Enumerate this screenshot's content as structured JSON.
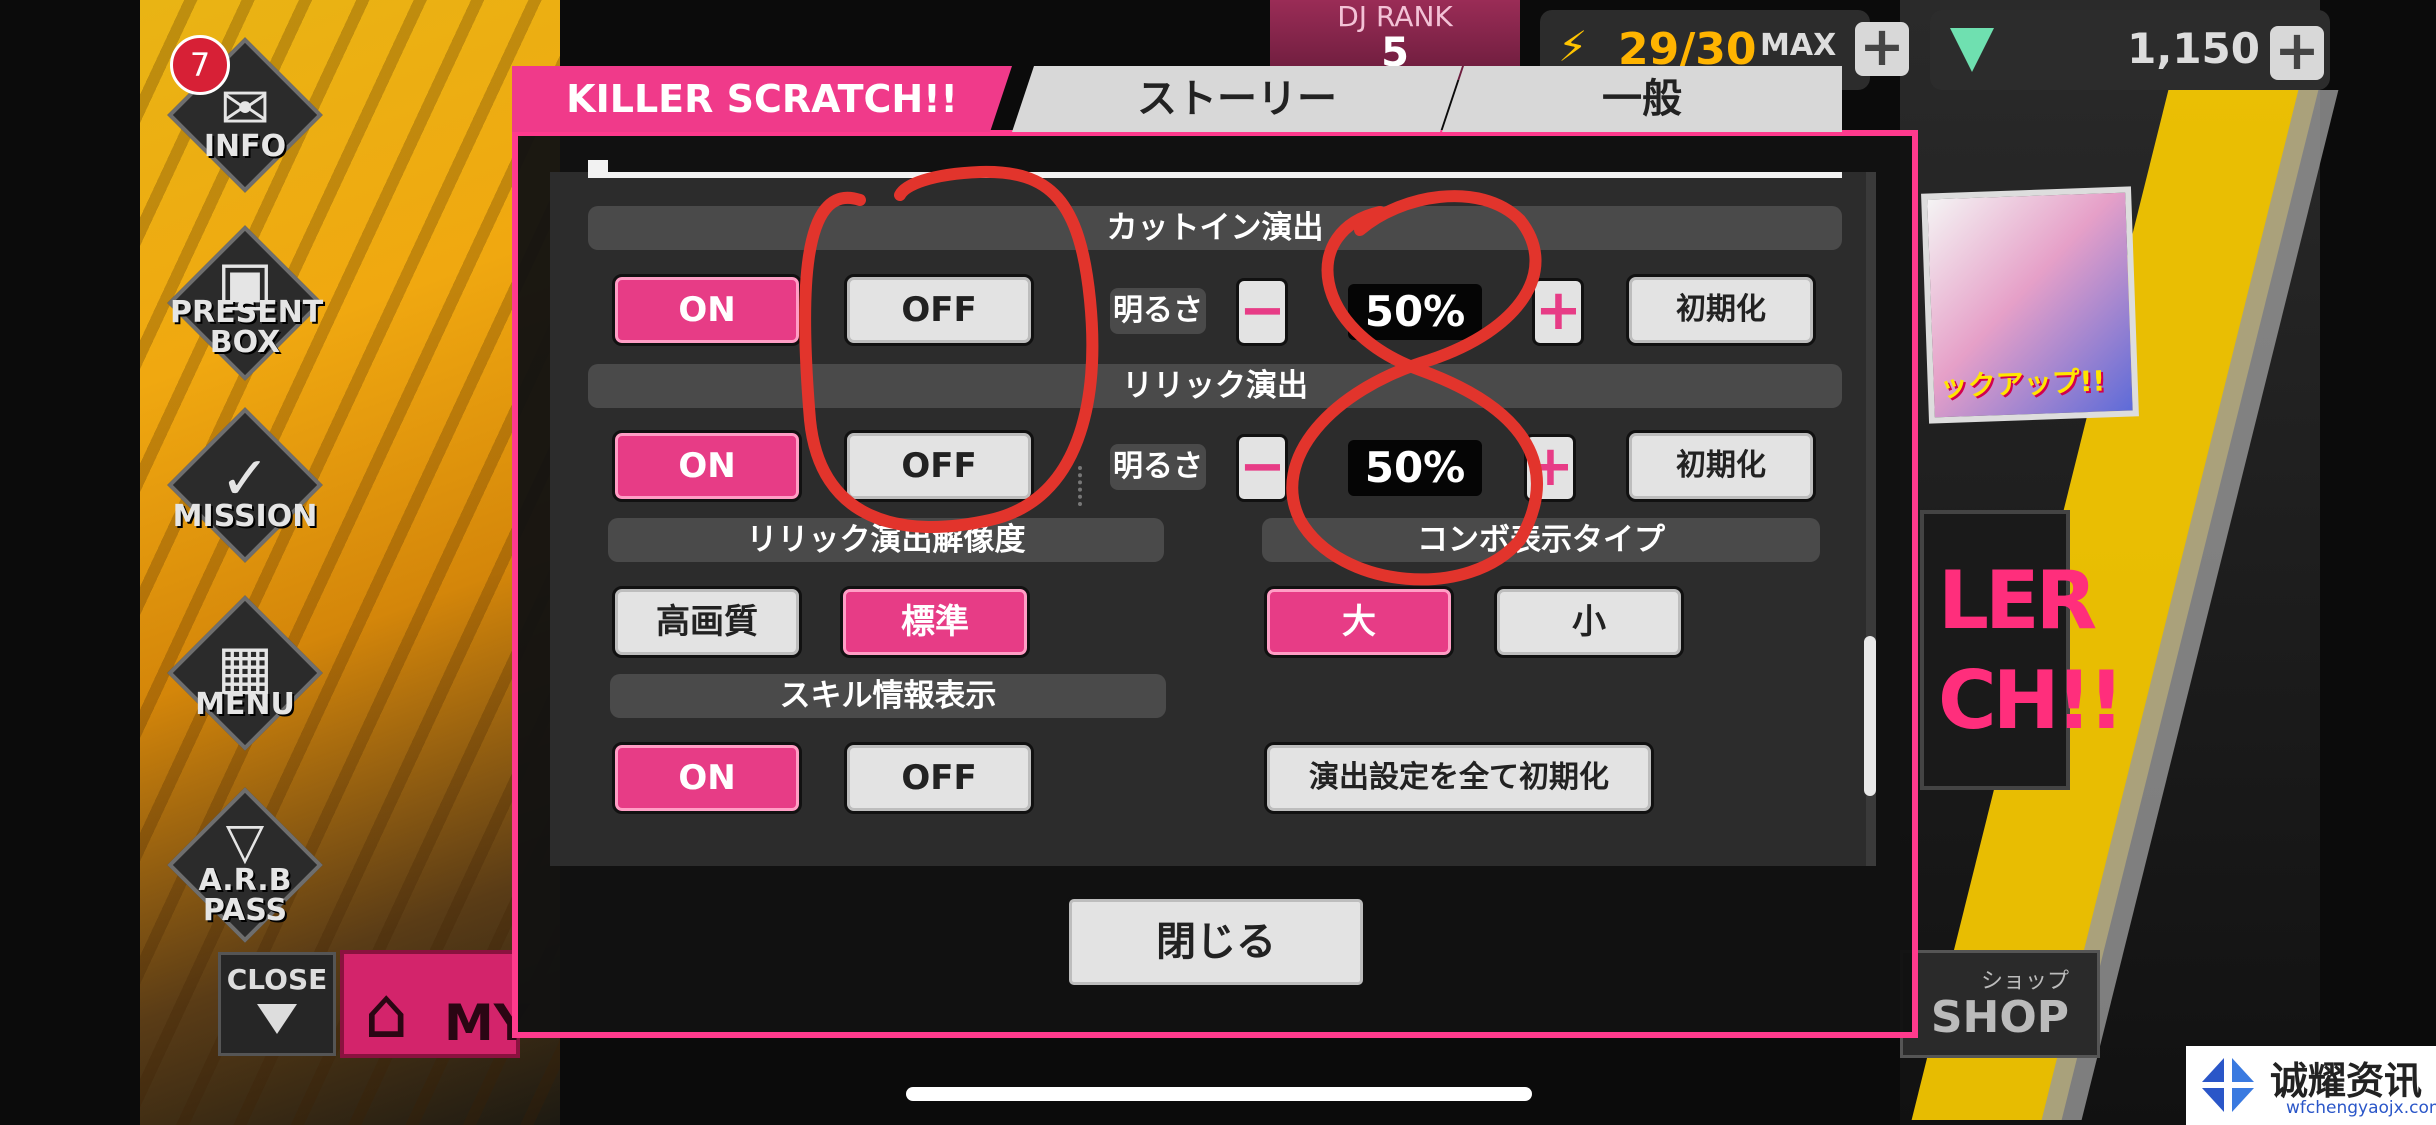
{
  "header": {
    "dj_rank_label": "DJ RANK",
    "dj_rank_value": "5",
    "stamina": "29/30",
    "stamina_max_label": "MAX",
    "gems": "1,150"
  },
  "sidebar": {
    "info_badge": "7",
    "items": [
      {
        "label": "INFO",
        "icon": "mail-icon"
      },
      {
        "label": "PRESENT\nBOX",
        "icon": "gift-icon"
      },
      {
        "label": "MISSION",
        "icon": "check-icon"
      },
      {
        "label": "MENU",
        "icon": "grid-icon"
      },
      {
        "label": "A.R.B\nPASS",
        "icon": "pass-icon"
      }
    ],
    "close_label": "CLOSE",
    "my_label": "MY"
  },
  "right": {
    "pickup_text": "ックアップ!!",
    "shop_kana": "ショップ",
    "shop_label": "SHOP"
  },
  "dialog": {
    "tabs": [
      {
        "label": "KILLER SCRATCH!!",
        "active": true
      },
      {
        "label": "ストーリー",
        "active": false
      },
      {
        "label": "一般",
        "active": false
      }
    ],
    "cutin": {
      "header": "カットイン演出",
      "on_label": "ON",
      "off_label": "OFF",
      "brightness_label": "明るさ",
      "minus": "−",
      "value": "50%",
      "plus": "+",
      "reset_label": "初期化"
    },
    "lyric": {
      "header": "リリック演出",
      "on_label": "ON",
      "off_label": "OFF",
      "brightness_label": "明るさ",
      "minus": "−",
      "value": "50%",
      "plus": "+",
      "reset_label": "初期化"
    },
    "lyric_resolution": {
      "header": "リリック演出解像度",
      "high_label": "高画質",
      "standard_label": "標準",
      "selected": "標準"
    },
    "combo_type": {
      "header": "コンボ表示タイプ",
      "large_label": "大",
      "small_label": "小",
      "selected": "大"
    },
    "skill_info": {
      "header": "スキル情報表示",
      "on_label": "ON",
      "off_label": "OFF",
      "selected": "ON"
    },
    "reset_all_label": "演出設定を全て初期化",
    "close_label": "閉じる"
  },
  "watermark": {
    "title": "诚耀资讯",
    "url": "wfchengyaojx.com"
  },
  "colors": {
    "accent_pink": "#e73c86",
    "annotation_red": "#e2342c"
  }
}
